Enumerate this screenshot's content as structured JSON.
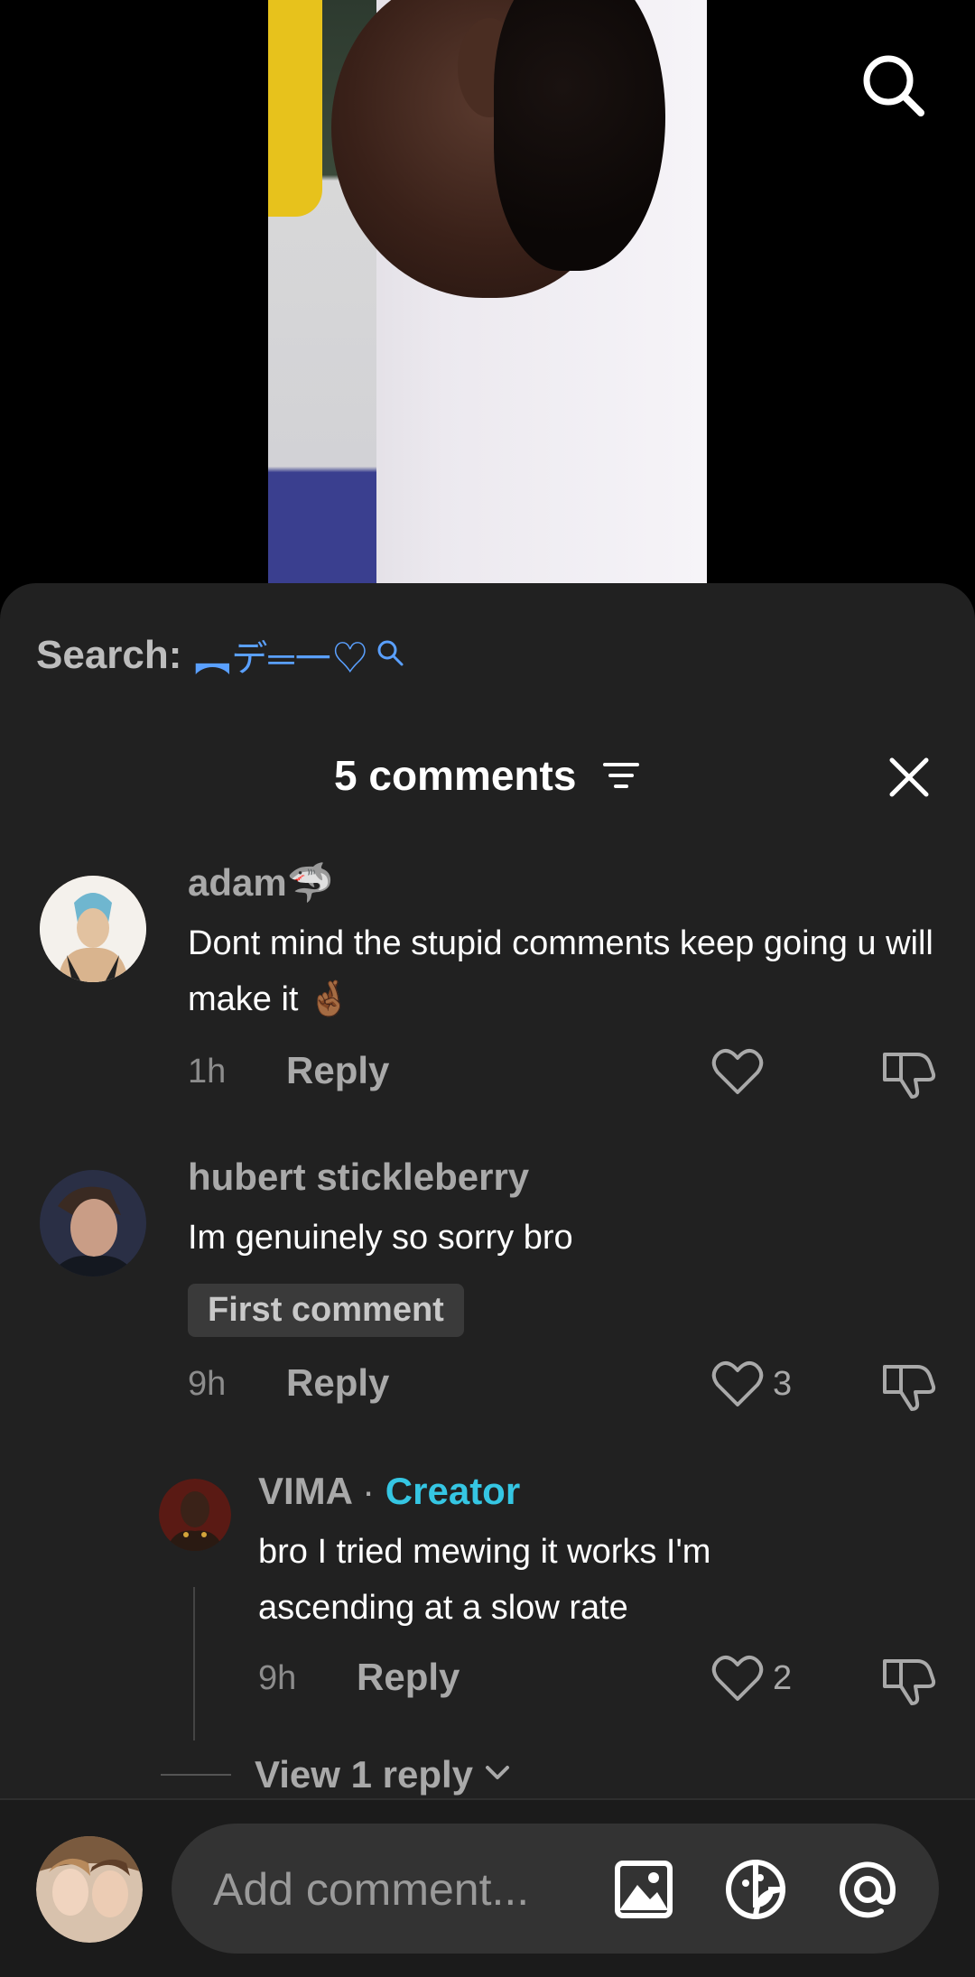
{
  "search": {
    "label": "Search:",
    "term": "︻デ═一",
    "term_suffix": "♡"
  },
  "comments_header": {
    "title": "5 comments"
  },
  "comments": [
    {
      "username": "adam🦈",
      "text": "Dont mind the stupid comments keep going u will make it 🤞🏾",
      "time": "1h",
      "reply_label": "Reply",
      "likes": ""
    },
    {
      "username": "hubert stickleberry",
      "text": "Im genuinely so sorry bro",
      "badge": "First comment",
      "time": "9h",
      "reply_label": "Reply",
      "likes": "3"
    }
  ],
  "reply": {
    "username": "VIMA",
    "separator": "·",
    "creator_label": "Creator",
    "text": "bro I tried mewing it works I'm ascending at a slow rate",
    "time": "9h",
    "reply_label": "Reply",
    "likes": "2"
  },
  "view_replies": {
    "label": "View 1 reply"
  },
  "input": {
    "placeholder": "Add comment..."
  },
  "colors": {
    "sheet_bg": "#212121",
    "creator_accent": "#35c6e3",
    "search_term": "#5aa0ff"
  }
}
